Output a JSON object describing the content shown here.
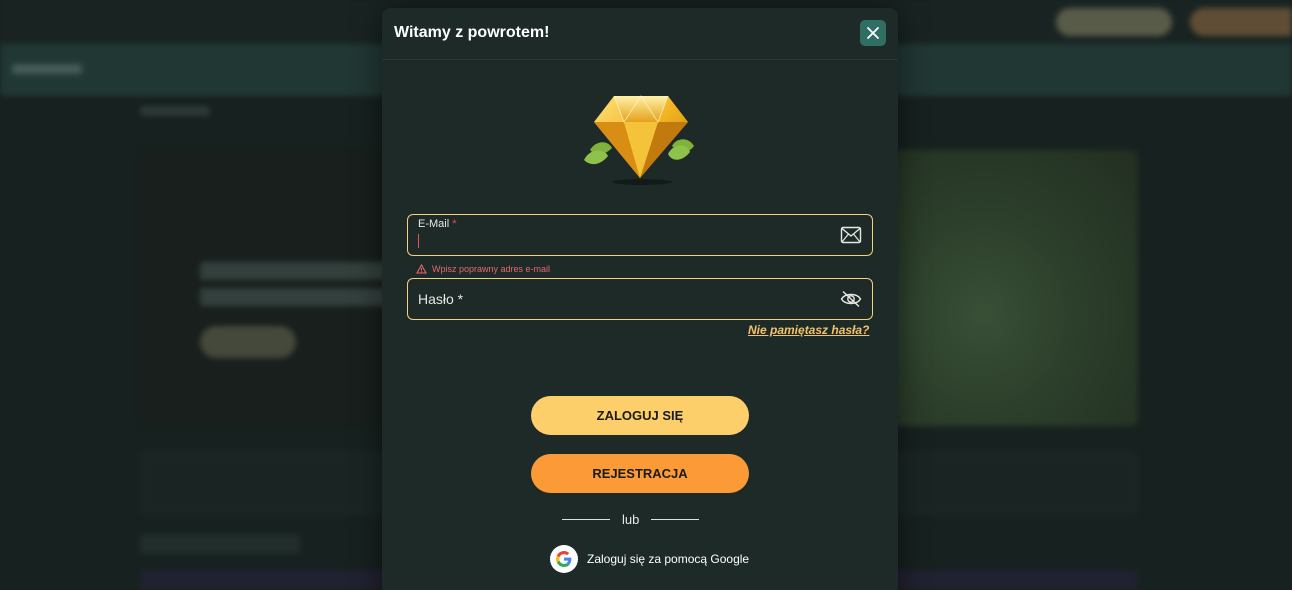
{
  "modal": {
    "title": "Witamy z powrotem!"
  },
  "form": {
    "email_label": "E-Mail",
    "required_mark": "*",
    "email_error": "Wpisz poprawny adres e-mail",
    "password_label": "Hasło *",
    "forgot_password": "Nie pamiętasz hasła?"
  },
  "actions": {
    "login_label": "ZALOGUJ SIĘ",
    "register_label": "REJESTRACJA",
    "or_label": "lub",
    "google_label": "Zaloguj się za pomocą Google"
  },
  "colors": {
    "accent_yellow": "#fdcf6b",
    "accent_orange": "#fb9a37",
    "error_red": "#e46a6a",
    "close_teal": "#2f6e62"
  },
  "icons": {
    "close": "close-icon",
    "email": "envelope-icon",
    "password": "eye-slash-icon",
    "error": "warning-icon",
    "google": "google-icon",
    "logo": "diamond-icon"
  }
}
